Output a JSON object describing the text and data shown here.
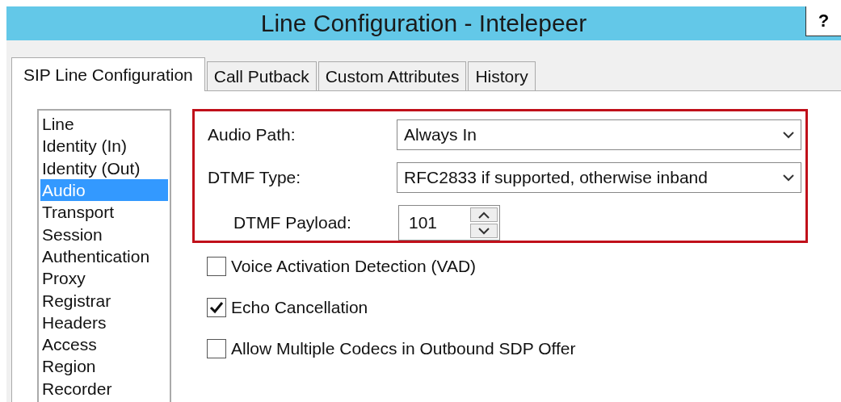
{
  "window": {
    "title": "Line Configuration - Intelepeer",
    "help": "?"
  },
  "tabs": [
    {
      "label": "SIP Line Configuration",
      "selected": true
    },
    {
      "label": "Call Putback",
      "selected": false
    },
    {
      "label": "Custom Attributes",
      "selected": false
    },
    {
      "label": "History",
      "selected": false
    }
  ],
  "sidebar": {
    "items": [
      {
        "label": "Line",
        "selected": false
      },
      {
        "label": "Identity (In)",
        "selected": false
      },
      {
        "label": "Identity (Out)",
        "selected": false
      },
      {
        "label": "Audio",
        "selected": true
      },
      {
        "label": "Transport",
        "selected": false
      },
      {
        "label": "Session",
        "selected": false
      },
      {
        "label": "Authentication",
        "selected": false
      },
      {
        "label": "Proxy",
        "selected": false
      },
      {
        "label": "Registrar",
        "selected": false
      },
      {
        "label": "Headers",
        "selected": false
      },
      {
        "label": "Access",
        "selected": false
      },
      {
        "label": "Region",
        "selected": false
      },
      {
        "label": "Recorder",
        "selected": false
      }
    ]
  },
  "highlighted_fields": [
    {
      "kind": "dropdown",
      "label": "Audio Path:",
      "value": "Always In"
    },
    {
      "kind": "dropdown",
      "label": "DTMF Type:",
      "value": "RFC2833 if supported, otherwise inband"
    },
    {
      "kind": "spinner",
      "label": "DTMF Payload:",
      "value": "101"
    }
  ],
  "options": [
    {
      "label": "Voice Activation Detection (VAD)",
      "checked": false
    },
    {
      "label": "Echo Cancellation",
      "checked": true
    },
    {
      "label": "Allow Multiple Codecs in Outbound SDP Offer",
      "checked": false
    }
  ]
}
